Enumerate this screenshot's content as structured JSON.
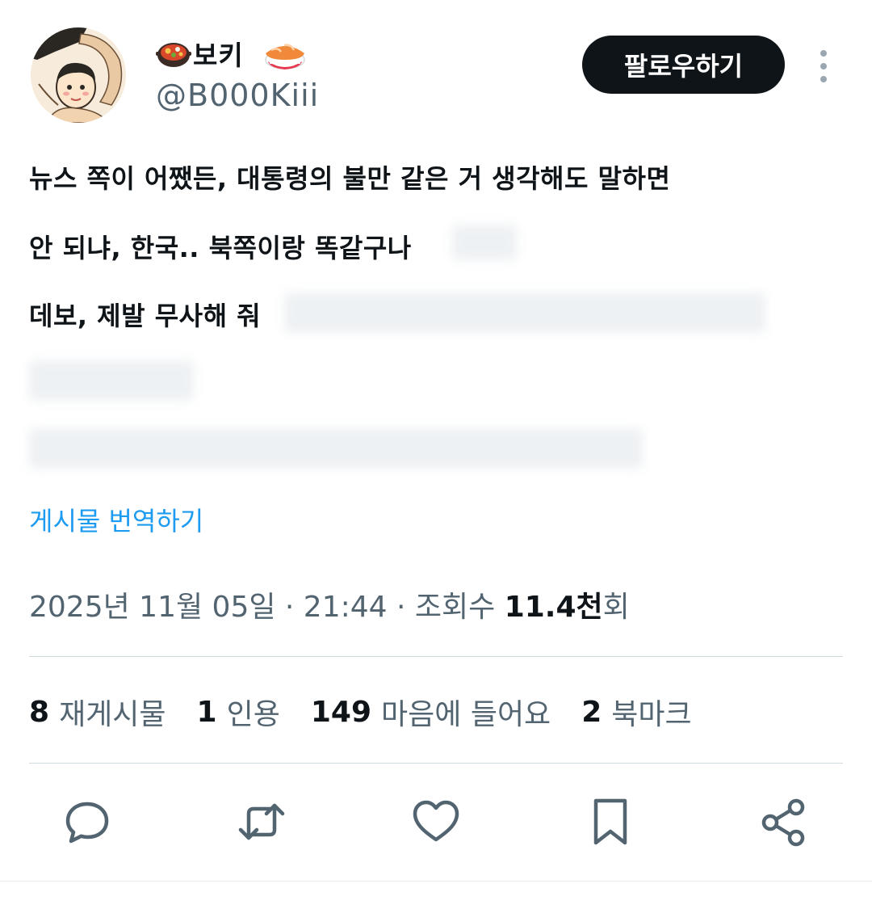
{
  "author": {
    "display_name": "보키",
    "handle": "@B000Kiii",
    "name_emojis": [
      "stew-pot-icon",
      "sushi-icon"
    ]
  },
  "follow_label": "팔로우하기",
  "tweet": {
    "lines": [
      "뉴스 쪽이 어쨌든, 대통령의 불만 같은 거 생각해도 말하면",
      "안 되냐, 한국.. 북쪽이랑 똑같구나",
      "데보, 제발 무사해 줘"
    ]
  },
  "translate_label": "게시물 번역하기",
  "meta": {
    "datetime": "2025년 11월 05일 · 21:44 · 조회수 ",
    "views_count": "11.4천",
    "views_suffix": "회"
  },
  "stats": [
    {
      "count": "8",
      "label": "재게시물"
    },
    {
      "count": "1",
      "label": "인용"
    },
    {
      "count": "149",
      "label": "마음에 들어요"
    },
    {
      "count": "2",
      "label": "북마크"
    }
  ],
  "actions": [
    "reply-icon",
    "repost-icon",
    "like-icon",
    "bookmark-icon",
    "share-icon"
  ],
  "colors": {
    "text": "#0f1419",
    "secondary": "#536471",
    "link": "#1d9bf0",
    "button_bg": "#0f1419",
    "divider": "#cfd9de"
  }
}
